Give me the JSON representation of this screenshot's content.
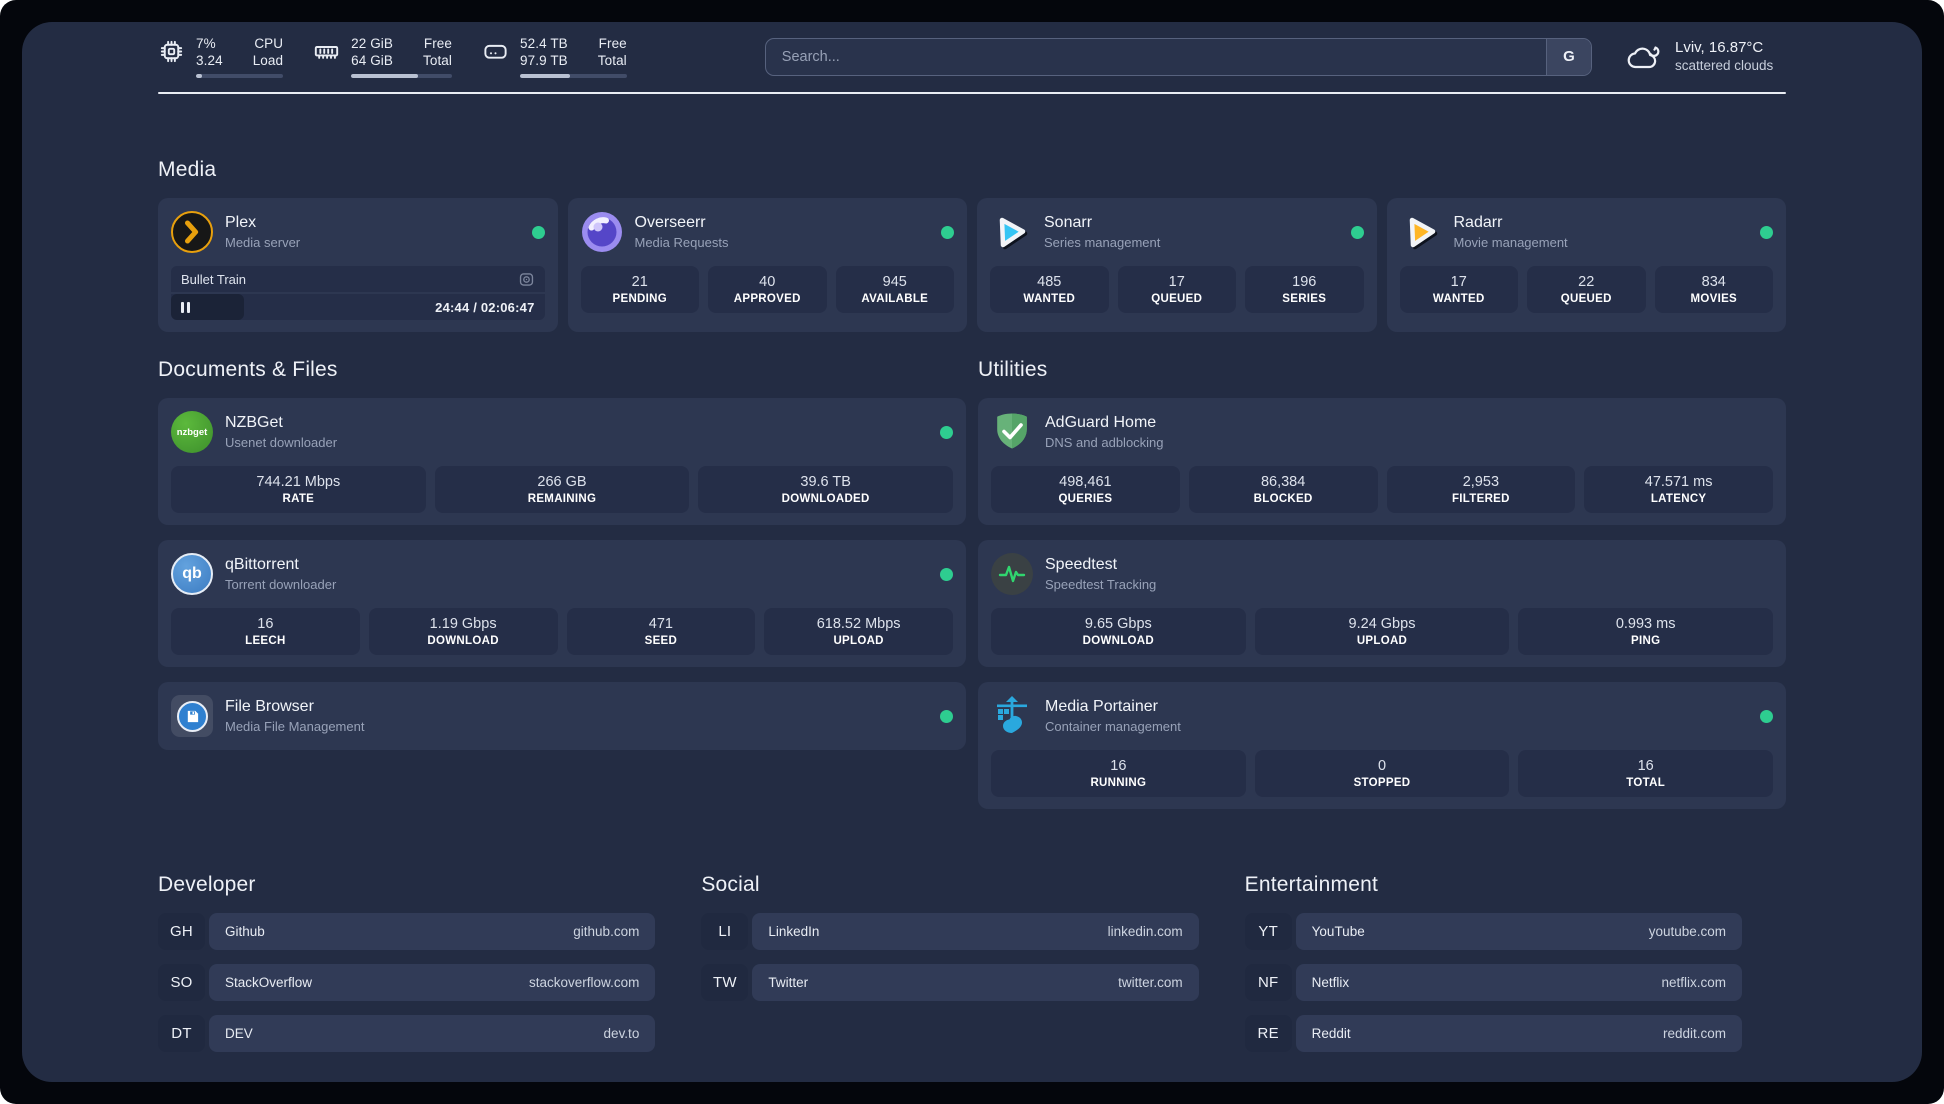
{
  "topbar": {
    "resources": [
      {
        "icon": "cpu-icon",
        "values": [
          "7%",
          "3.24"
        ],
        "labels": [
          "CPU",
          "Load"
        ],
        "progress_pct": 7
      },
      {
        "icon": "memory-icon",
        "values": [
          "22 GiB",
          "64 GiB"
        ],
        "labels": [
          "Free",
          "Total"
        ],
        "progress_pct": 66
      },
      {
        "icon": "disk-icon",
        "values": [
          "52.4 TB",
          "97.9 TB"
        ],
        "labels": [
          "Free",
          "Total"
        ],
        "progress_pct": 47
      }
    ],
    "search": {
      "placeholder": "Search...",
      "button": "G"
    },
    "weather": {
      "summary": "Lviv, 16.87°C",
      "condition": "scattered clouds"
    }
  },
  "service_groups": [
    {
      "title": "Media",
      "services": [
        {
          "name": "Plex",
          "description": "Media server",
          "icon": "plex-icon",
          "online": true,
          "player": {
            "title": "Bullet Train",
            "progress_pct": 19.5,
            "time": "24:44 / 02:06:47"
          }
        },
        {
          "name": "Overseerr",
          "description": "Media Requests",
          "icon": "overseerr-icon",
          "online": true,
          "stats": [
            {
              "value": "21",
              "label": "PENDING"
            },
            {
              "value": "40",
              "label": "APPROVED"
            },
            {
              "value": "945",
              "label": "AVAILABLE"
            }
          ]
        },
        {
          "name": "Sonarr",
          "description": "Series management",
          "icon": "sonarr-icon",
          "online": true,
          "stats": [
            {
              "value": "485",
              "label": "WANTED"
            },
            {
              "value": "17",
              "label": "QUEUED"
            },
            {
              "value": "196",
              "label": "SERIES"
            }
          ]
        },
        {
          "name": "Radarr",
          "description": "Movie management",
          "icon": "radarr-icon",
          "online": true,
          "stats": [
            {
              "value": "17",
              "label": "WANTED"
            },
            {
              "value": "22",
              "label": "QUEUED"
            },
            {
              "value": "834",
              "label": "MOVIES"
            }
          ]
        }
      ]
    },
    {
      "title": "Documents & Files",
      "services": [
        {
          "name": "NZBGet",
          "description": "Usenet downloader",
          "icon": "nzbget-icon",
          "online": true,
          "stats": [
            {
              "value": "744.21 Mbps",
              "label": "RATE"
            },
            {
              "value": "266 GB",
              "label": "REMAINING"
            },
            {
              "value": "39.6 TB",
              "label": "DOWNLOADED"
            }
          ]
        },
        {
          "name": "qBittorrent",
          "description": "Torrent downloader",
          "icon": "qbittorrent-icon",
          "online": true,
          "stats": [
            {
              "value": "16",
              "label": "LEECH"
            },
            {
              "value": "1.19 Gbps",
              "label": "DOWNLOAD"
            },
            {
              "value": "471",
              "label": "SEED"
            },
            {
              "value": "618.52 Mbps",
              "label": "UPLOAD"
            }
          ]
        },
        {
          "name": "File Browser",
          "description": "Media File Management",
          "icon": "filebrowser-icon",
          "online": true,
          "stats": []
        }
      ]
    },
    {
      "title": "Utilities",
      "services": [
        {
          "name": "AdGuard Home",
          "description": "DNS and adblocking",
          "icon": "adguard-icon",
          "online": false,
          "stats": [
            {
              "value": "498,461",
              "label": "QUERIES"
            },
            {
              "value": "86,384",
              "label": "BLOCKED"
            },
            {
              "value": "2,953",
              "label": "FILTERED"
            },
            {
              "value": "47.571 ms",
              "label": "LATENCY"
            }
          ]
        },
        {
          "name": "Speedtest",
          "description": "Speedtest Tracking",
          "icon": "speedtest-icon",
          "online": false,
          "stats": [
            {
              "value": "9.65 Gbps",
              "label": "DOWNLOAD"
            },
            {
              "value": "9.24 Gbps",
              "label": "UPLOAD"
            },
            {
              "value": "0.993 ms",
              "label": "PING"
            }
          ]
        },
        {
          "name": "Media Portainer",
          "description": "Container management",
          "icon": "portainer-icon",
          "online": true,
          "stats": [
            {
              "value": "16",
              "label": "RUNNING"
            },
            {
              "value": "0",
              "label": "STOPPED"
            },
            {
              "value": "16",
              "label": "TOTAL"
            }
          ]
        }
      ]
    }
  ],
  "link_groups": [
    {
      "title": "Developer",
      "links": [
        {
          "abbr": "GH",
          "name": "Github",
          "url": "github.com"
        },
        {
          "abbr": "SO",
          "name": "StackOverflow",
          "url": "stackoverflow.com"
        },
        {
          "abbr": "DT",
          "name": "DEV",
          "url": "dev.to"
        }
      ]
    },
    {
      "title": "Social",
      "links": [
        {
          "abbr": "LI",
          "name": "LinkedIn",
          "url": "linkedin.com"
        },
        {
          "abbr": "TW",
          "name": "Twitter",
          "url": "twitter.com"
        }
      ]
    },
    {
      "title": "Entertainment",
      "links": [
        {
          "abbr": "YT",
          "name": "YouTube",
          "url": "youtube.com"
        },
        {
          "abbr": "NF",
          "name": "Netflix",
          "url": "netflix.com"
        },
        {
          "abbr": "RE",
          "name": "Reddit",
          "url": "reddit.com"
        }
      ]
    }
  ],
  "colors": {
    "status_online": "#2ecd90",
    "plex_accent": "#e8a00d",
    "divider": "#e9edf4"
  }
}
